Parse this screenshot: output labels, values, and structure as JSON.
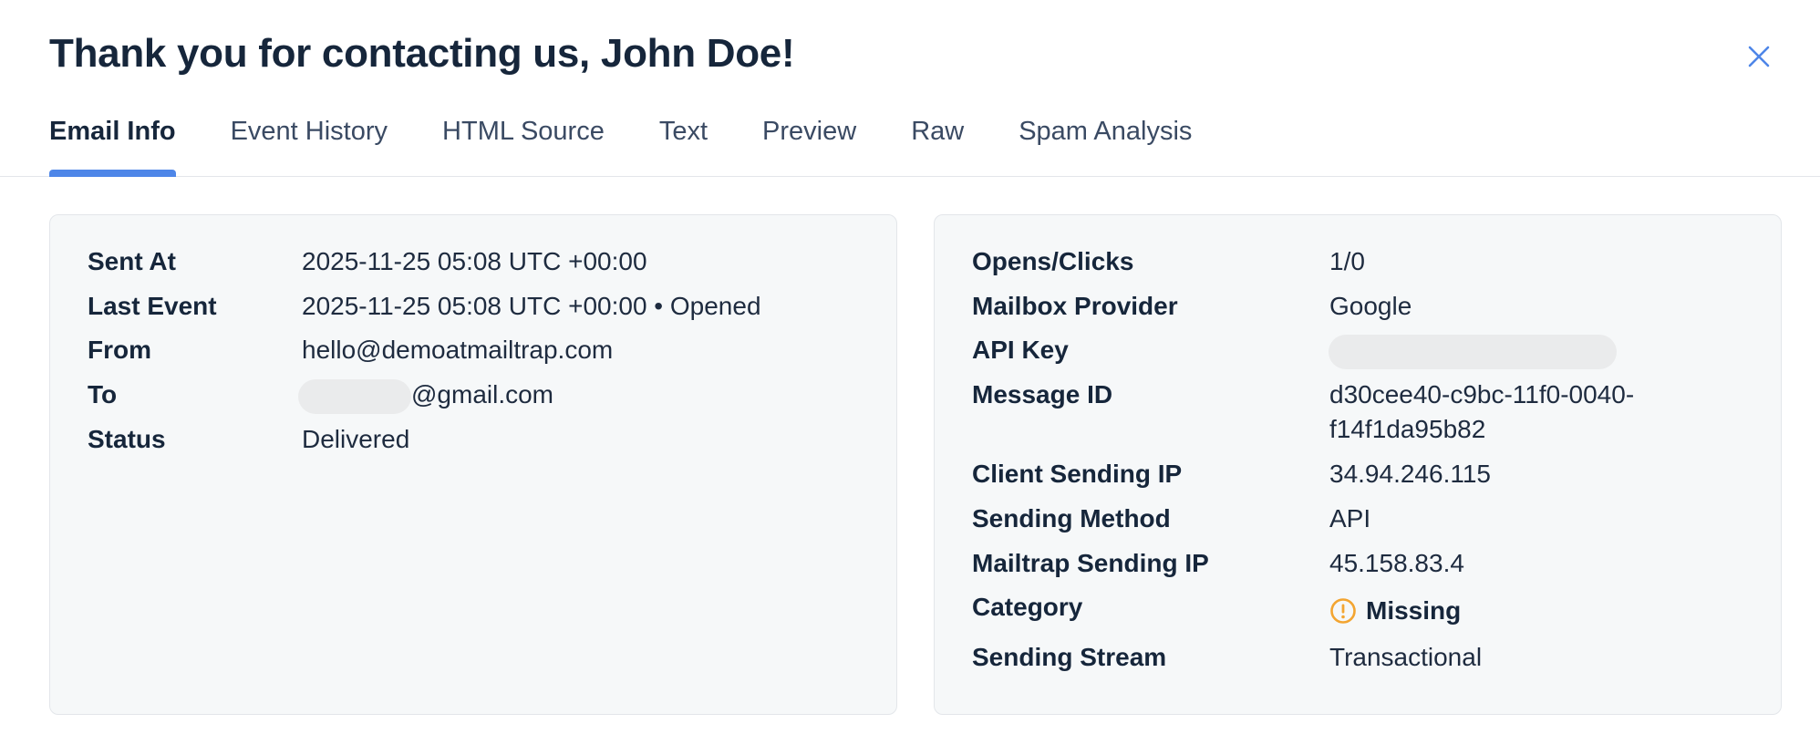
{
  "header": {
    "title": "Thank you for contacting us, John Doe!",
    "close_icon": "close-icon"
  },
  "tabs": [
    {
      "label": "Email Info",
      "active": true
    },
    {
      "label": "Event History",
      "active": false
    },
    {
      "label": "HTML Source",
      "active": false
    },
    {
      "label": "Text",
      "active": false
    },
    {
      "label": "Preview",
      "active": false
    },
    {
      "label": "Raw",
      "active": false
    },
    {
      "label": "Spam Analysis",
      "active": false
    }
  ],
  "email_info": {
    "sent_at": {
      "label": "Sent At",
      "value": "2025-11-25 05:08 UTC +00:00"
    },
    "last_event": {
      "label": "Last Event",
      "value": "2025-11-25 05:08 UTC +00:00 • Opened"
    },
    "from": {
      "label": "From",
      "value": "hello@demoatmailtrap.com"
    },
    "to": {
      "label": "To",
      "value": "@gmail.com"
    },
    "status": {
      "label": "Status",
      "value": "Delivered"
    }
  },
  "details": {
    "opens_clicks": {
      "label": "Opens/Clicks",
      "value": "1/0"
    },
    "mailbox_provider": {
      "label": "Mailbox Provider",
      "value": "Google"
    },
    "api_key": {
      "label": "API Key"
    },
    "message_id": {
      "label": "Message ID",
      "value_line1": "d30cee40-c9bc-11f0-0040-",
      "value_line2": "f14f1da95b82"
    },
    "client_sending_ip": {
      "label": "Client Sending IP",
      "value": "34.94.246.115"
    },
    "sending_method": {
      "label": "Sending Method",
      "value": "API"
    },
    "mailtrap_sending_ip": {
      "label": "Mailtrap Sending IP",
      "value": "45.158.83.4"
    },
    "category": {
      "label": "Category",
      "value": "Missing",
      "icon": "warning-icon"
    },
    "sending_stream": {
      "label": "Sending Stream",
      "value": "Transactional"
    }
  },
  "colors": {
    "accent": "#4e86e8",
    "warning": "#f3a531",
    "card_bg": "#f6f8f9",
    "text": "#16263b"
  }
}
